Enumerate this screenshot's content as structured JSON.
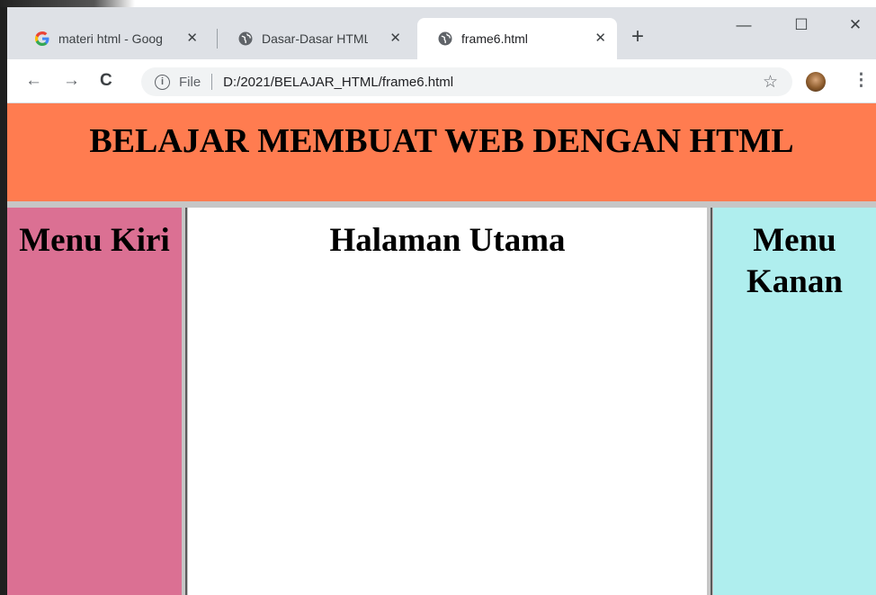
{
  "browser": {
    "tabs": [
      {
        "title": "materi html - Goog",
        "favicon": "google-g-icon",
        "active": false
      },
      {
        "title": "Dasar-Dasar HTML",
        "favicon": "globe-icon",
        "active": false
      },
      {
        "title": "frame6.html",
        "favicon": "globe-icon",
        "active": true
      }
    ],
    "new_tab_label": "+",
    "window_controls": {
      "minimize": "—",
      "maximize": "☐",
      "close": "✕"
    },
    "address": {
      "scheme_label": "File",
      "url": "D:/2021/BELAJAR_HTML/frame6.html"
    }
  },
  "page": {
    "header_title": "BELAJAR MEMBUAT WEB DENGAN HTML",
    "left_frame_title": "Menu Kiri",
    "main_frame_title": "Halaman Utama",
    "right_frame_title": "Menu Kanan"
  },
  "colors": {
    "header_bg": "#ff7c50",
    "left_bg": "#db7093",
    "main_bg": "#ffffff",
    "right_bg": "#afeeee"
  }
}
